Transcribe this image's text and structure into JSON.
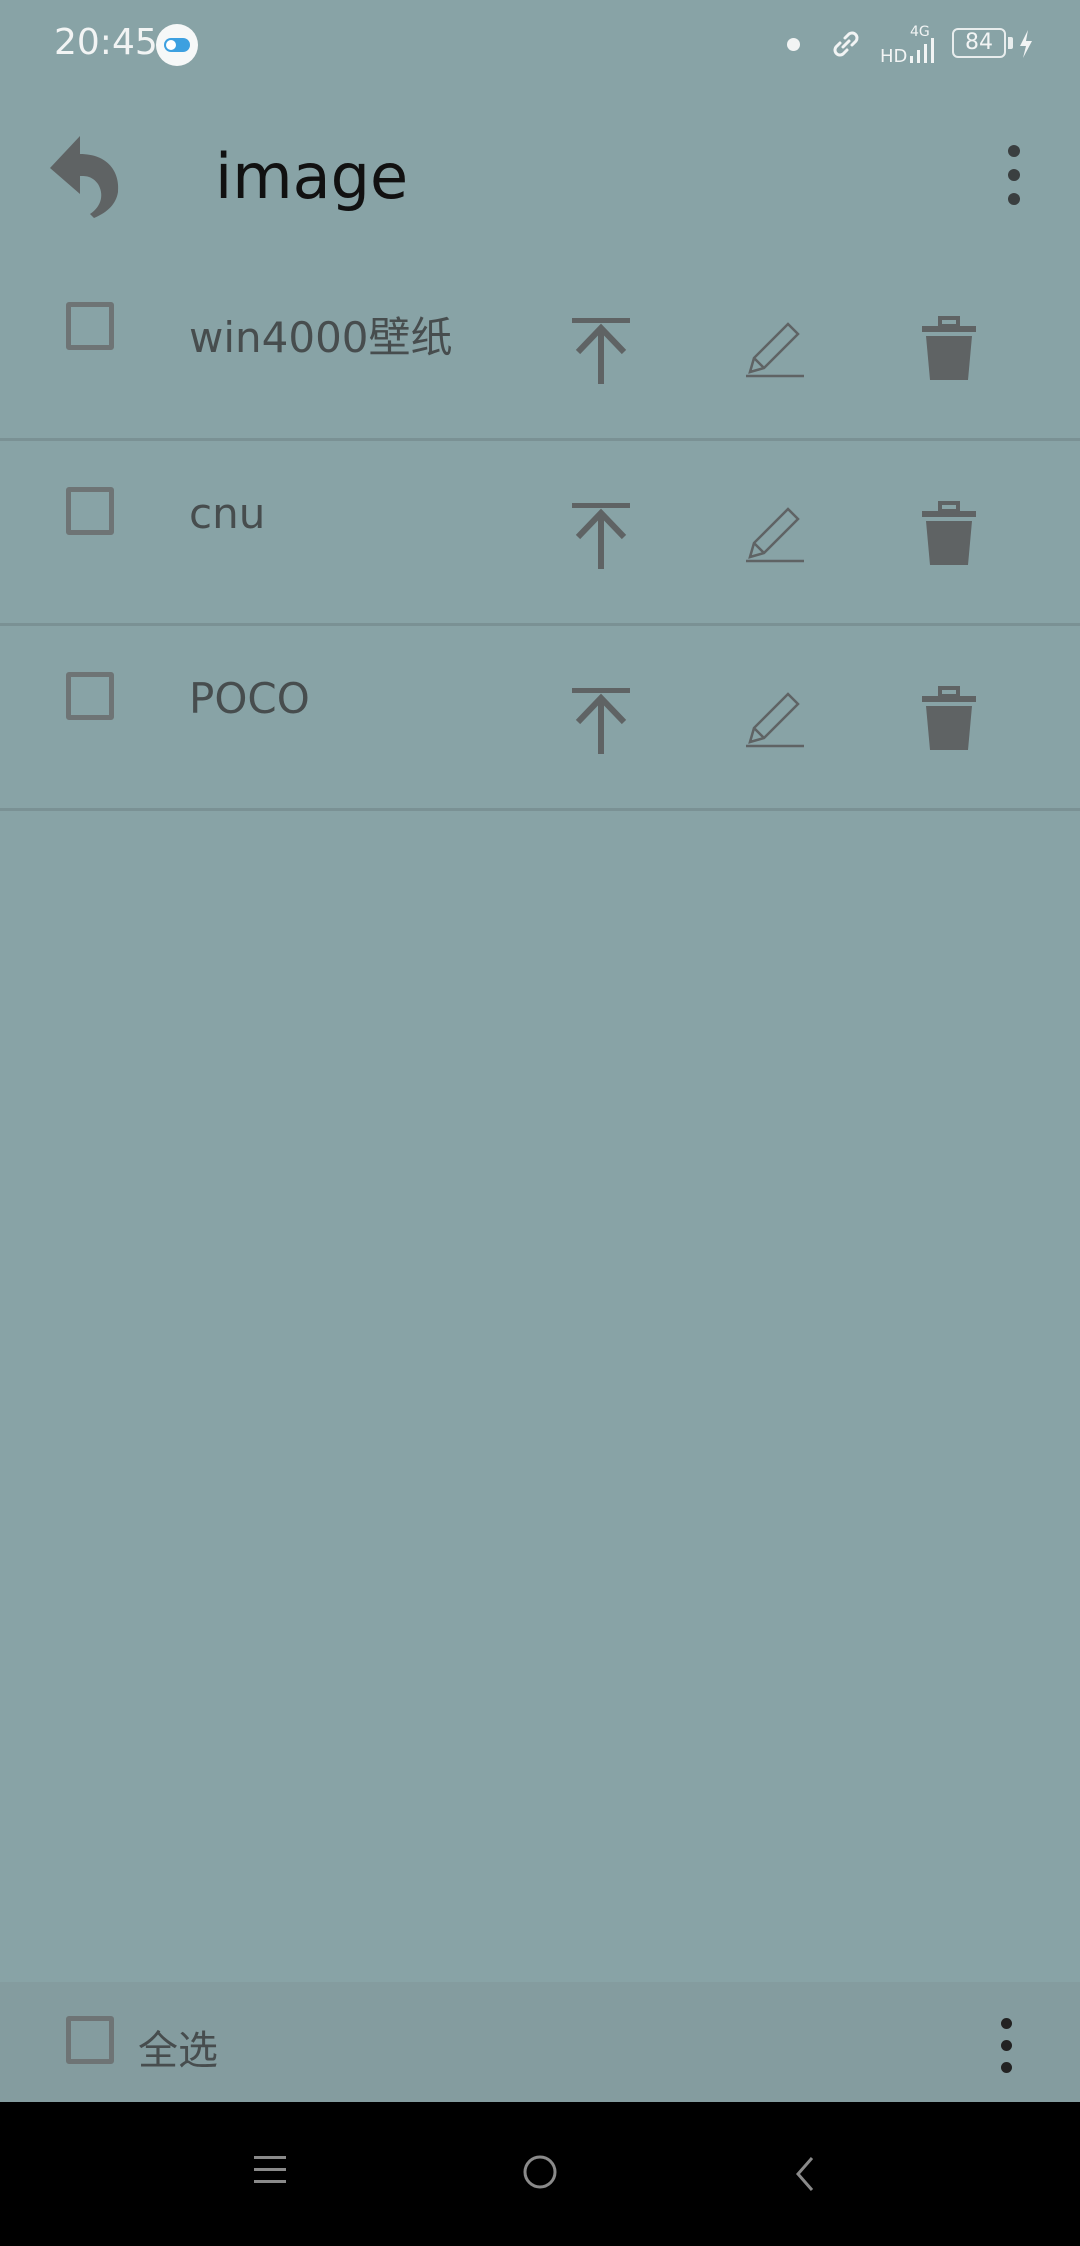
{
  "status_bar": {
    "time": "20:45",
    "network": "4G",
    "hd": "HD",
    "battery": "84"
  },
  "app_bar": {
    "title": "image"
  },
  "folders": [
    {
      "name": "win4000壁纸"
    },
    {
      "name": "cnu"
    },
    {
      "name": "POCO"
    }
  ],
  "footer": {
    "select_all_label": "全选"
  },
  "icons": {
    "back": "back-arrow-icon",
    "menu": "more-vert-icon",
    "upload": "upload-icon",
    "edit": "pencil-icon",
    "delete": "trash-icon",
    "nav_recent": "menu-lines-icon",
    "nav_home": "circle-icon",
    "nav_back": "chevron-left-icon"
  },
  "colors": {
    "background": "#88a3a6",
    "footer": "#849c9f",
    "nav_bar": "#000000",
    "icon": "#5f6364",
    "divider": "#7a9194"
  }
}
